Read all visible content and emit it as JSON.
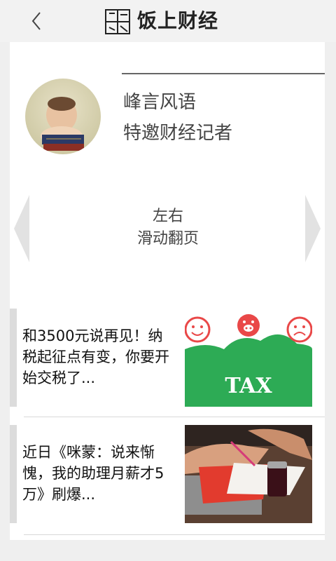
{
  "header": {
    "title": "饭上财经",
    "logo_text": "饭上财经",
    "back_icon": "chevron-left-icon"
  },
  "author": {
    "name": "峰言风语",
    "role": "特邀财经记者",
    "avatar_icon": "baby-avatar"
  },
  "swipe_hint": {
    "line1": "左右",
    "line2": "滑动翻页",
    "left_icon": "arrow-left-icon",
    "right_icon": "arrow-right-icon"
  },
  "news": [
    {
      "title": "和3500元说再见！纳税起征点有变，你要开始交税了...",
      "thumb_label": "TAX",
      "thumb_icon": "tax-illustration"
    },
    {
      "title": "近日《咪蒙：说来惭愧，我的助理月薪才5万》刷爆...",
      "thumb_icon": "desk-photo"
    }
  ],
  "colors": {
    "accent_green": "#2dab55",
    "tax_red": "#e94848"
  }
}
